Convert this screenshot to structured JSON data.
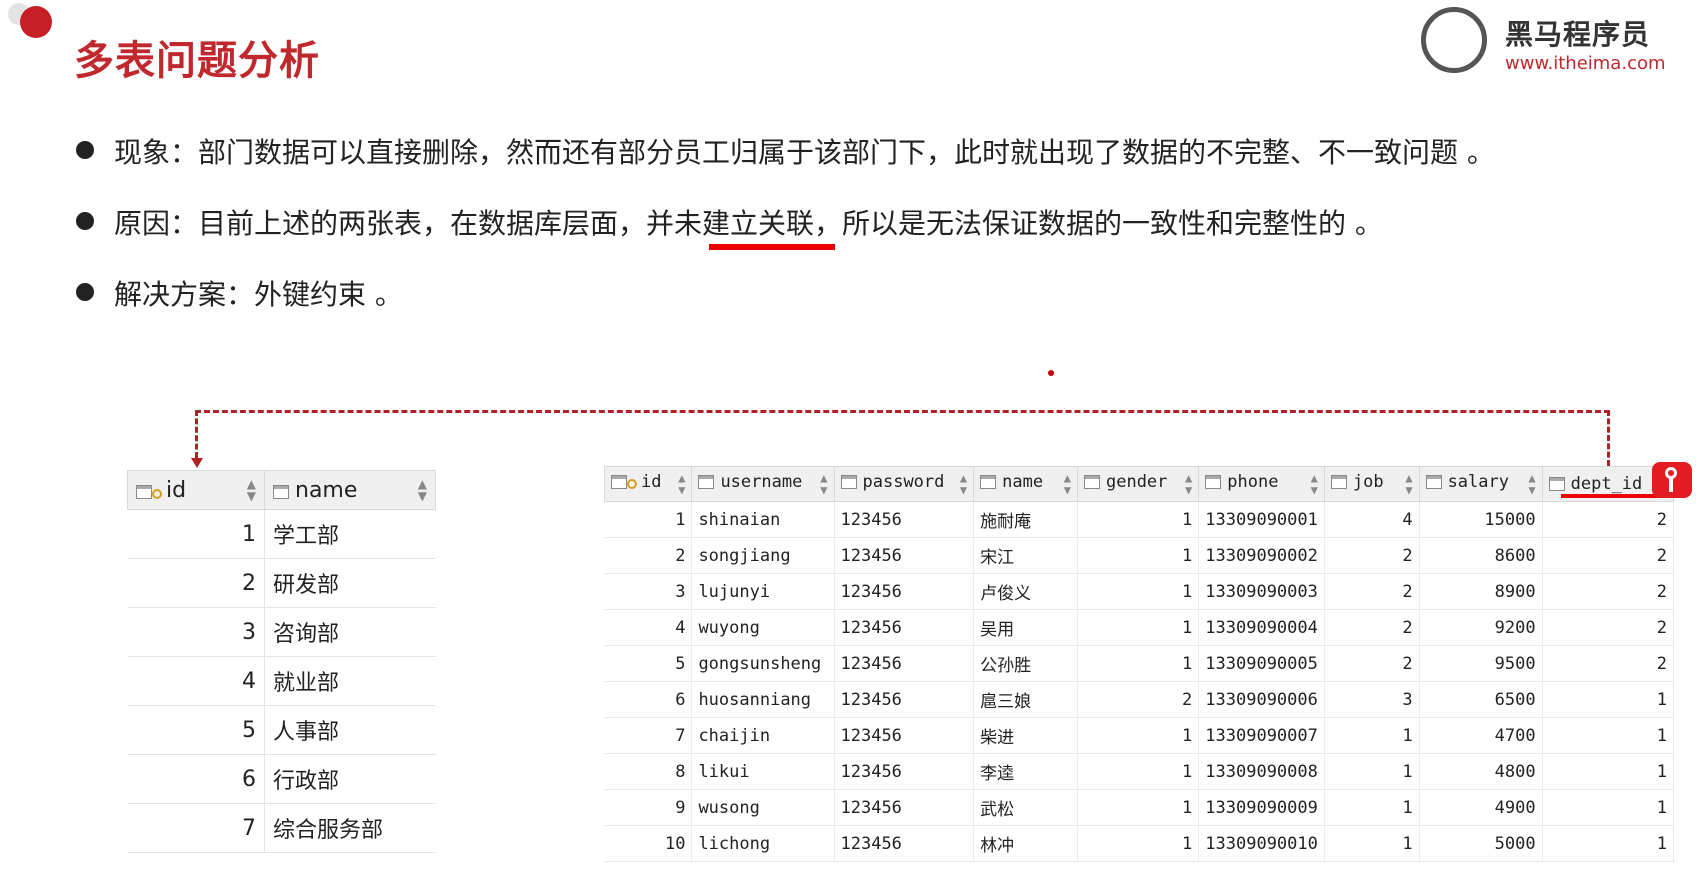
{
  "slide": {
    "title": "多表问题分析",
    "bullets": [
      {
        "text": "现象：部门数据可以直接删除，然而还有部分员工归属于该部门下，此时就出现了数据的不完整、不一致问题 。"
      },
      {
        "text_before": "原因：目前上述的两张表，在数据库层面，并",
        "text_highlight": "未建立关联",
        "text_after": "，所以是无法保证数据的一致性和完整性的 。"
      },
      {
        "text": "解决方案：外键约束  。"
      }
    ]
  },
  "logo": {
    "name": "黑马程序员",
    "url": "www.itheima.com",
    "icon": "horse-logo-icon"
  },
  "dept_table": {
    "columns": [
      "id",
      "name"
    ],
    "rows": [
      [
        "1",
        "学工部"
      ],
      [
        "2",
        "研发部"
      ],
      [
        "3",
        "咨询部"
      ],
      [
        "4",
        "就业部"
      ],
      [
        "5",
        "人事部"
      ],
      [
        "6",
        "行政部"
      ],
      [
        "7",
        "综合服务部"
      ]
    ]
  },
  "emp_table": {
    "columns": [
      "id",
      "username",
      "password",
      "name",
      "gender",
      "phone",
      "job",
      "salary",
      "dept_id"
    ],
    "rows": [
      [
        "1",
        "shinaian",
        "123456",
        "施耐庵",
        "1",
        "13309090001",
        "4",
        "15000",
        "2"
      ],
      [
        "2",
        "songjiang",
        "123456",
        "宋江",
        "1",
        "13309090002",
        "2",
        "8600",
        "2"
      ],
      [
        "3",
        "lujunyi",
        "123456",
        "卢俊义",
        "1",
        "13309090003",
        "2",
        "8900",
        "2"
      ],
      [
        "4",
        "wuyong",
        "123456",
        "吴用",
        "1",
        "13309090004",
        "2",
        "9200",
        "2"
      ],
      [
        "5",
        "gongsunsheng",
        "123456",
        "公孙胜",
        "1",
        "13309090005",
        "2",
        "9500",
        "2"
      ],
      [
        "6",
        "huosanniang",
        "123456",
        "扈三娘",
        "2",
        "13309090006",
        "3",
        "6500",
        "1"
      ],
      [
        "7",
        "chaijin",
        "123456",
        "柴进",
        "1",
        "13309090007",
        "1",
        "4700",
        "1"
      ],
      [
        "8",
        "likui",
        "123456",
        "李逵",
        "1",
        "13309090008",
        "1",
        "4800",
        "1"
      ],
      [
        "9",
        "wusong",
        "123456",
        "武松",
        "1",
        "13309090009",
        "1",
        "4900",
        "1"
      ],
      [
        "10",
        "lichong",
        "123456",
        "林冲",
        "1",
        "13309090010",
        "1",
        "5000",
        "1"
      ]
    ]
  },
  "colors": {
    "accent": "#c0282d",
    "fk": "#e31b23"
  }
}
